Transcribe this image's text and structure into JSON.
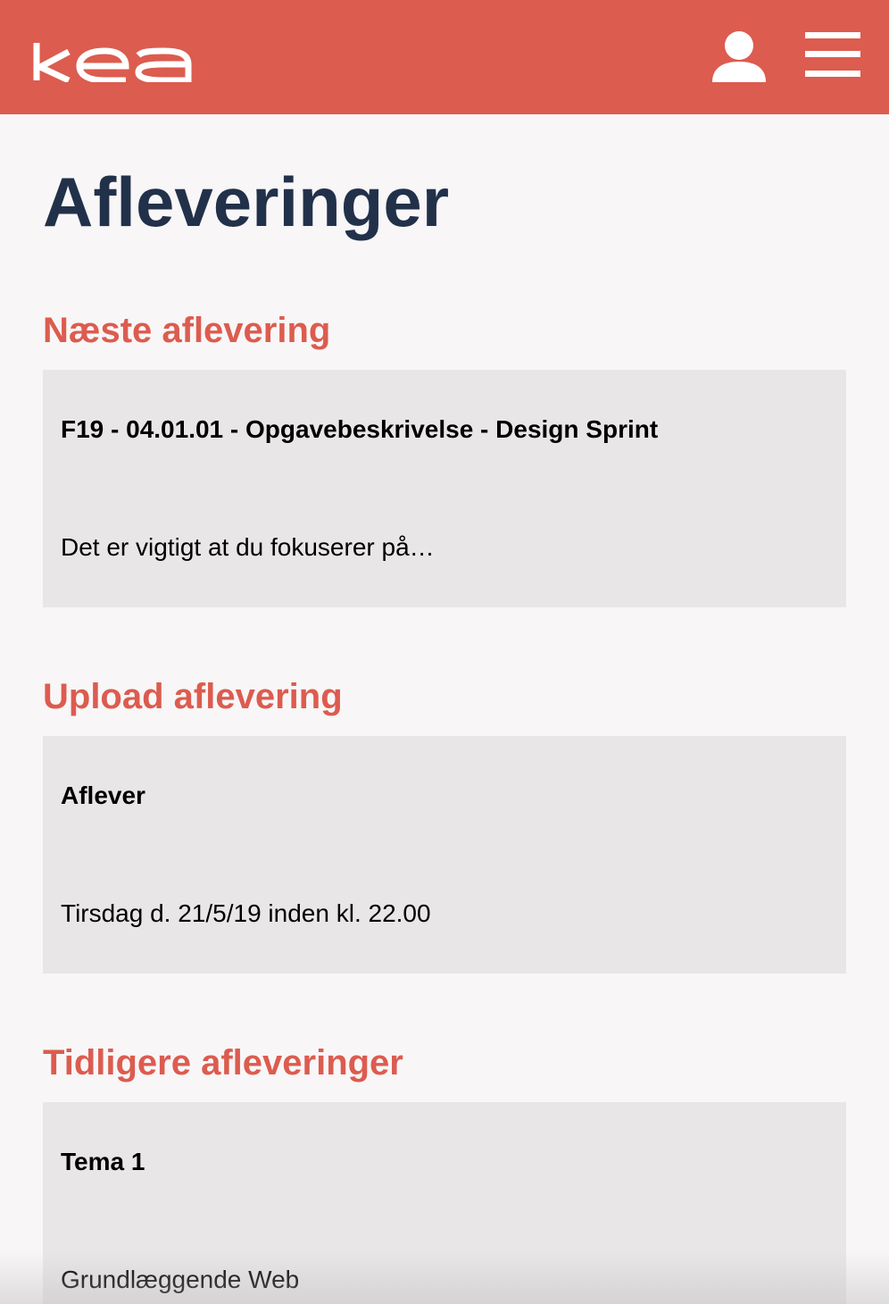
{
  "header": {
    "logo_text": "kea",
    "brand_color": "#dc5c4f",
    "icons": {
      "user": "user-icon",
      "menu": "hamburger-menu-icon"
    }
  },
  "page": {
    "title": "Afleveringer",
    "title_color": "#22314a"
  },
  "sections": [
    {
      "heading": "Næste aflevering",
      "card": {
        "title": "F19 - 04.01.01 - Opgavebeskrivelse - Design Sprint",
        "text": "Det er vigtigt at du fokuserer på…"
      }
    },
    {
      "heading": "Upload aflevering",
      "card": {
        "title": "Aflever",
        "text": "Tirsdag d. 21/5/19 inden kl. 22.00"
      }
    },
    {
      "heading": "Tidligere afleveringer",
      "card": {
        "title": "Tema 1",
        "text": "Grundlæggende Web"
      }
    }
  ]
}
